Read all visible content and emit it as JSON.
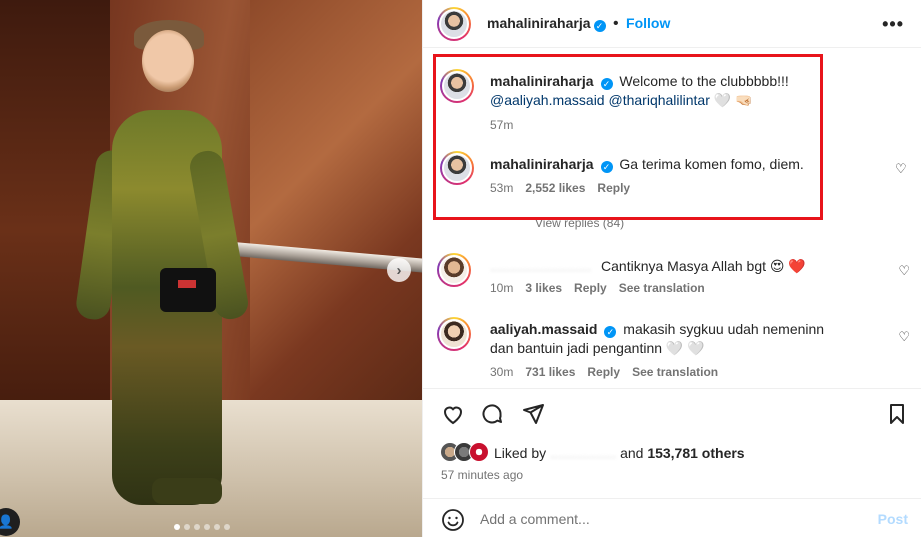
{
  "post": {
    "carousel_dots": 6,
    "carousel_active_index": 0,
    "next_icon": "chevron-right-icon"
  },
  "header": {
    "username": "mahaliniraharja",
    "follow_label": "Follow",
    "more_icon": "more-options-icon"
  },
  "comments": [
    {
      "username": "mahaliniraharja",
      "text": "Welcome to the clubbbbb!!!",
      "mentions": [
        "@aaliyah.massaid",
        "@thariqhalilintar"
      ],
      "emoji": "🤍 🤜🏻",
      "time": "57m"
    },
    {
      "username": "mahaliniraharja",
      "text": "Ga terima komen fomo, diem.",
      "time": "53m",
      "likes": "2,552 likes",
      "reply_label": "Reply"
    },
    {
      "username": "",
      "text": "Cantiknya Masya Allah bgt 😍 ❤️",
      "time": "10m",
      "likes": "3 likes",
      "reply_label": "Reply",
      "translate_label": "See translation"
    },
    {
      "username": "aaliyah.massaid",
      "text": "makasih sygkuu udah nemeninn dan bantuin jadi pengantinn 🤍 🤍",
      "time": "30m",
      "likes": "731 likes",
      "reply_label": "Reply",
      "translate_label": "See translation"
    }
  ],
  "view_replies": "View replies (84)",
  "actions": {
    "liked_by_prefix": "Liked by",
    "liked_by_suffix": "and",
    "likes_count": "153,781 others",
    "time_ago": "57 minutes ago"
  },
  "comment_box": {
    "placeholder": "Add a comment...",
    "post_label": "Post"
  },
  "colors": {
    "accent": "#0095f6",
    "highlight_border": "#e8141b",
    "mention": "#00376b",
    "post_disabled": "#b3dbff"
  }
}
